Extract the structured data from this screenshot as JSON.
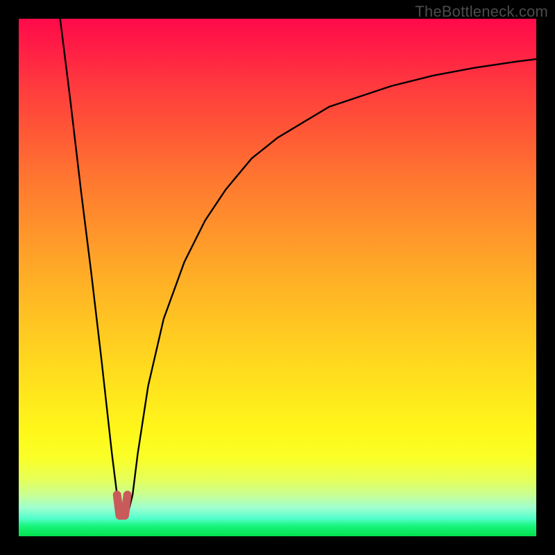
{
  "watermark": "TheBottleneck.com",
  "chart_data": {
    "type": "line",
    "title": "",
    "xlabel": "",
    "ylabel": "",
    "xlim": [
      0,
      100
    ],
    "ylim": [
      0,
      100
    ],
    "grid": false,
    "legend": false,
    "series": [
      {
        "name": "bottleneck-curve",
        "x": [
          8,
          10,
          12,
          14,
          16,
          18,
          19,
          20,
          21,
          22,
          23,
          25,
          28,
          32,
          36,
          40,
          45,
          50,
          55,
          60,
          66,
          72,
          80,
          88,
          96,
          100
        ],
        "y": [
          100,
          84,
          67,
          51,
          34,
          16,
          8,
          4,
          4,
          8,
          16,
          29,
          42,
          53,
          61,
          67,
          73,
          77,
          80,
          83,
          85,
          87,
          89,
          90.5,
          91.7,
          92.2
        ]
      },
      {
        "name": "marker",
        "x": [
          19,
          19.5,
          20.5,
          21
        ],
        "y": [
          8,
          4,
          4,
          8
        ]
      }
    ],
    "colors": {
      "curve": "#000000",
      "marker": "#c95a5a",
      "background_top": "#ff0a4a",
      "background_bottom": "#05e04e"
    },
    "notes": "V-shaped curve rendered over a red→yellow→green vertical gradient. Axis values are estimated from the plot area (0–100 each); no tick marks, labels, or legend are visible. A short brown-red U-shaped marker sits at the curve minimum near x≈20."
  }
}
